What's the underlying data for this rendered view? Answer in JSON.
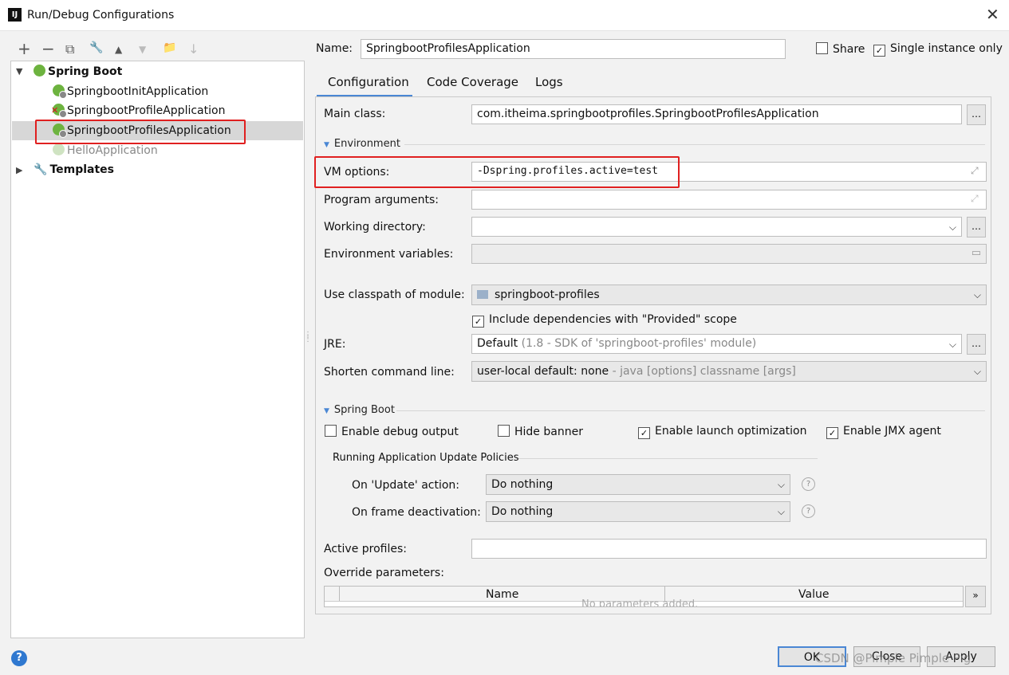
{
  "window": {
    "title": "Run/Debug Configurations",
    "app_icon_text": "IJ"
  },
  "toolbar": {
    "add": "+",
    "remove": "−",
    "copy": "⧉",
    "edit": "🔧",
    "up": "▲",
    "down": "▼",
    "folder": "📁",
    "sort": "↓"
  },
  "tree": {
    "spring_boot_label": "Spring Boot",
    "items": [
      {
        "label": "SpringbootInitApplication"
      },
      {
        "label": "SpringbootProfileApplication"
      },
      {
        "label": "SpringbootProfilesApplication"
      },
      {
        "label": "HelloApplication"
      }
    ],
    "templates_label": "Templates"
  },
  "header": {
    "name_label": "Name:",
    "name_value": "SpringbootProfilesApplication",
    "share_label": "Share",
    "single_instance_label": "Single instance only"
  },
  "tabs": [
    {
      "label": "Configuration"
    },
    {
      "label": "Code Coverage"
    },
    {
      "label": "Logs"
    }
  ],
  "config": {
    "main_class_label": "Main class:",
    "main_class_value": "com.itheima.springbootprofiles.SpringbootProfilesApplication",
    "environment_section": "Environment",
    "vm_options_label": "VM options:",
    "vm_options_value": "-Dspring.profiles.active=test",
    "program_args_label": "Program arguments:",
    "working_dir_label": "Working directory:",
    "env_vars_label": "Environment variables:",
    "classpath_label": "Use classpath of module:",
    "classpath_value": "springboot-profiles",
    "include_deps_label": "Include dependencies with \"Provided\" scope",
    "jre_label": "JRE:",
    "jre_value": "Default",
    "jre_hint": "(1.8 - SDK of 'springboot-profiles' module)",
    "shorten_label": "Shorten command line:",
    "shorten_value": "user-local default: none",
    "shorten_hint": " - java [options] classname [args]",
    "spring_boot_section": "Spring Boot",
    "enable_debug_label": "Enable debug output",
    "hide_banner_label": "Hide banner",
    "launch_opt_label": "Enable launch optimization",
    "jmx_label": "Enable JMX agent",
    "policies_label": "Running Application Update Policies",
    "on_update_label": "On 'Update' action:",
    "on_update_value": "Do nothing",
    "on_frame_label": "On frame deactivation:",
    "on_frame_value": "Do nothing",
    "active_profiles_label": "Active profiles:",
    "override_label": "Override parameters:",
    "col_name": "Name",
    "col_value": "Value",
    "empty_text": "No parameters added.",
    "more": "»"
  },
  "footer": {
    "ok": "OK",
    "close": "Close",
    "apply": "Apply",
    "help": "?",
    "watermark": "CSDN @Pimple Pimple Pig"
  }
}
